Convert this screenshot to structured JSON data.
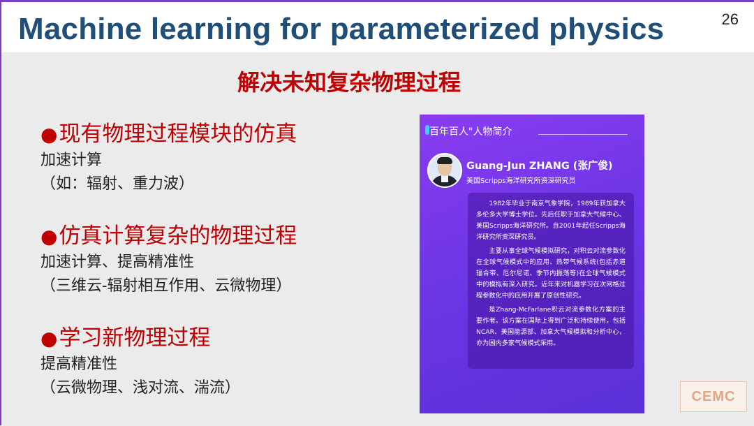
{
  "slide": {
    "title": "Machine learning for parameterized physics",
    "page_number": "26",
    "subtitle": "解决未知复杂物理过程"
  },
  "bullets": [
    {
      "marker": "●",
      "heading": "现有物理过程模块的仿真",
      "lines": [
        "加速计算",
        "（如：辐射、重力波）"
      ]
    },
    {
      "marker": "●",
      "heading": "仿真计算复杂的物理过程",
      "lines": [
        "加速计算、提高精准性",
        "（三维云-辐射相互作用、云微物理）"
      ]
    },
    {
      "marker": "●",
      "heading": "学习新物理过程",
      "lines": [
        "提高精准性",
        "（云微物理、浅对流、湍流）"
      ]
    }
  ],
  "card": {
    "header": "百年百人\"人物简介",
    "name": "Guang-Jun ZHANG (张广俊)",
    "role": "美国Scripps海洋研究所资深研究员",
    "bio": [
      "1982年毕业于南京气象学院，1989年获加拿大多伦多大学博士学位。先后任职于加拿大气候中心、美国Scripps海洋研究所。自2001年起任Scripps海洋研究所资深研究员。",
      "主要从事全球气候模拟研究，对积云对流参数化在全球气候模式中的应用、热带气候系统(包括赤道辐合带、厄尔尼诺、季节内振荡等)在全球气候模式中的模拟有深入研究。近年来对机器学习在次网格过程参数化中的应用开展了原创性研究。",
      "是Zhang-McFarlane积云对流参数化方案的主要作者。该方案在国际上得到广泛和持续使用，包括NCAR、美国能源部、加拿大气候模拟和分析中心，亦为国内多家气候模式采用。"
    ]
  },
  "logo": {
    "text": "CEMC"
  },
  "colors": {
    "title": "#1f4e79",
    "accent_red": "#c00000",
    "card_purple": "#6d36e6",
    "frame": "#7a3cc6"
  }
}
